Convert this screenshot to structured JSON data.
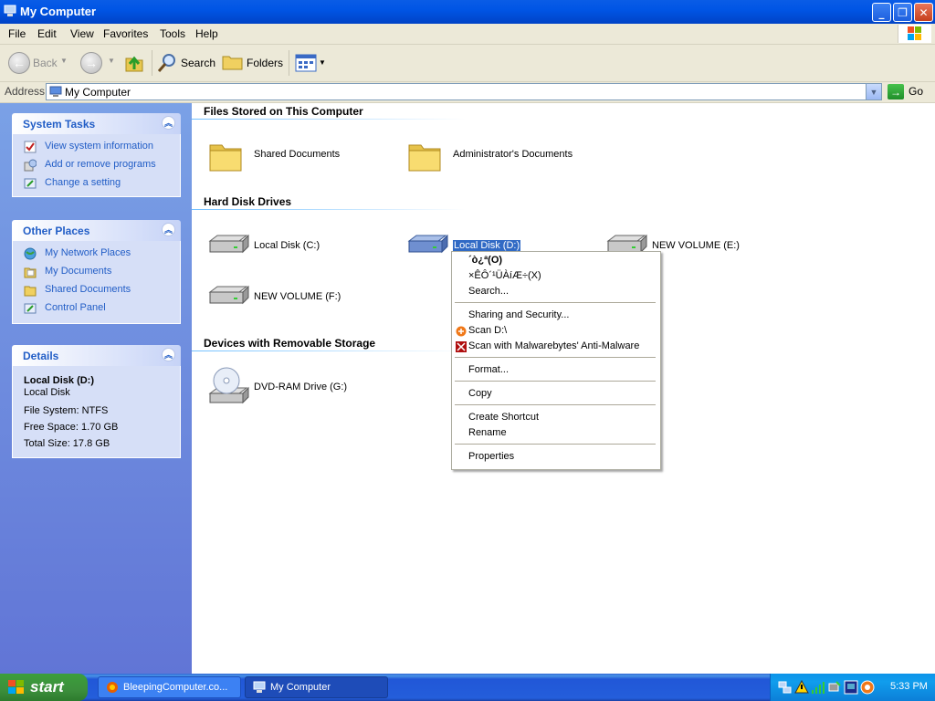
{
  "window": {
    "title": "My Computer"
  },
  "menu": [
    "File",
    "Edit",
    "View",
    "Favorites",
    "Tools",
    "Help"
  ],
  "toolbar": {
    "back": "Back",
    "search": "Search",
    "folders": "Folders"
  },
  "address": {
    "label": "Address",
    "value": "My Computer",
    "go": "Go"
  },
  "left": {
    "system_tasks": {
      "title": "System Tasks",
      "items": [
        "View system information",
        "Add or remove programs",
        "Change a setting"
      ]
    },
    "other_places": {
      "title": "Other Places",
      "items": [
        "My Network Places",
        "My Documents",
        "Shared Documents",
        "Control Panel"
      ]
    },
    "details": {
      "title": "Details",
      "name": "Local Disk (D:)",
      "type": "Local Disk",
      "fs": "File System: NTFS",
      "free": "Free Space: 1.70 GB",
      "total": "Total Size: 17.8 GB"
    }
  },
  "content": {
    "files_header": "Files Stored on This Computer",
    "files": [
      "Shared Documents",
      "Administrator's Documents"
    ],
    "hdd_header": "Hard Disk Drives",
    "drives": [
      "Local Disk (C:)",
      "Local Disk (D:)",
      "NEW VOLUME (E:)",
      "NEW VOLUME (F:)"
    ],
    "removable_header": "Devices with Removable Storage",
    "removable": [
      "DVD-RAM Drive (G:)"
    ]
  },
  "context_menu": {
    "open": "´ò¿ª(O)",
    "explore": "×ÊÔ´¹ÜÀíÆ÷(X)",
    "search": "Search...",
    "sharing": "Sharing and Security...",
    "scan": "Scan D:\\",
    "malwarebytes": "Scan with Malwarebytes' Anti-Malware",
    "format": "Format...",
    "copy": "Copy",
    "shortcut": "Create Shortcut",
    "rename": "Rename",
    "properties": "Properties"
  },
  "taskbar": {
    "start": "start",
    "tasks": [
      "BleepingComputer.co...",
      "My Computer"
    ],
    "clock": "5:33 PM"
  },
  "colors": {
    "xp_blue": "#0055e5",
    "selection": "#316ac5",
    "taskpane": "#7aa1e6"
  }
}
